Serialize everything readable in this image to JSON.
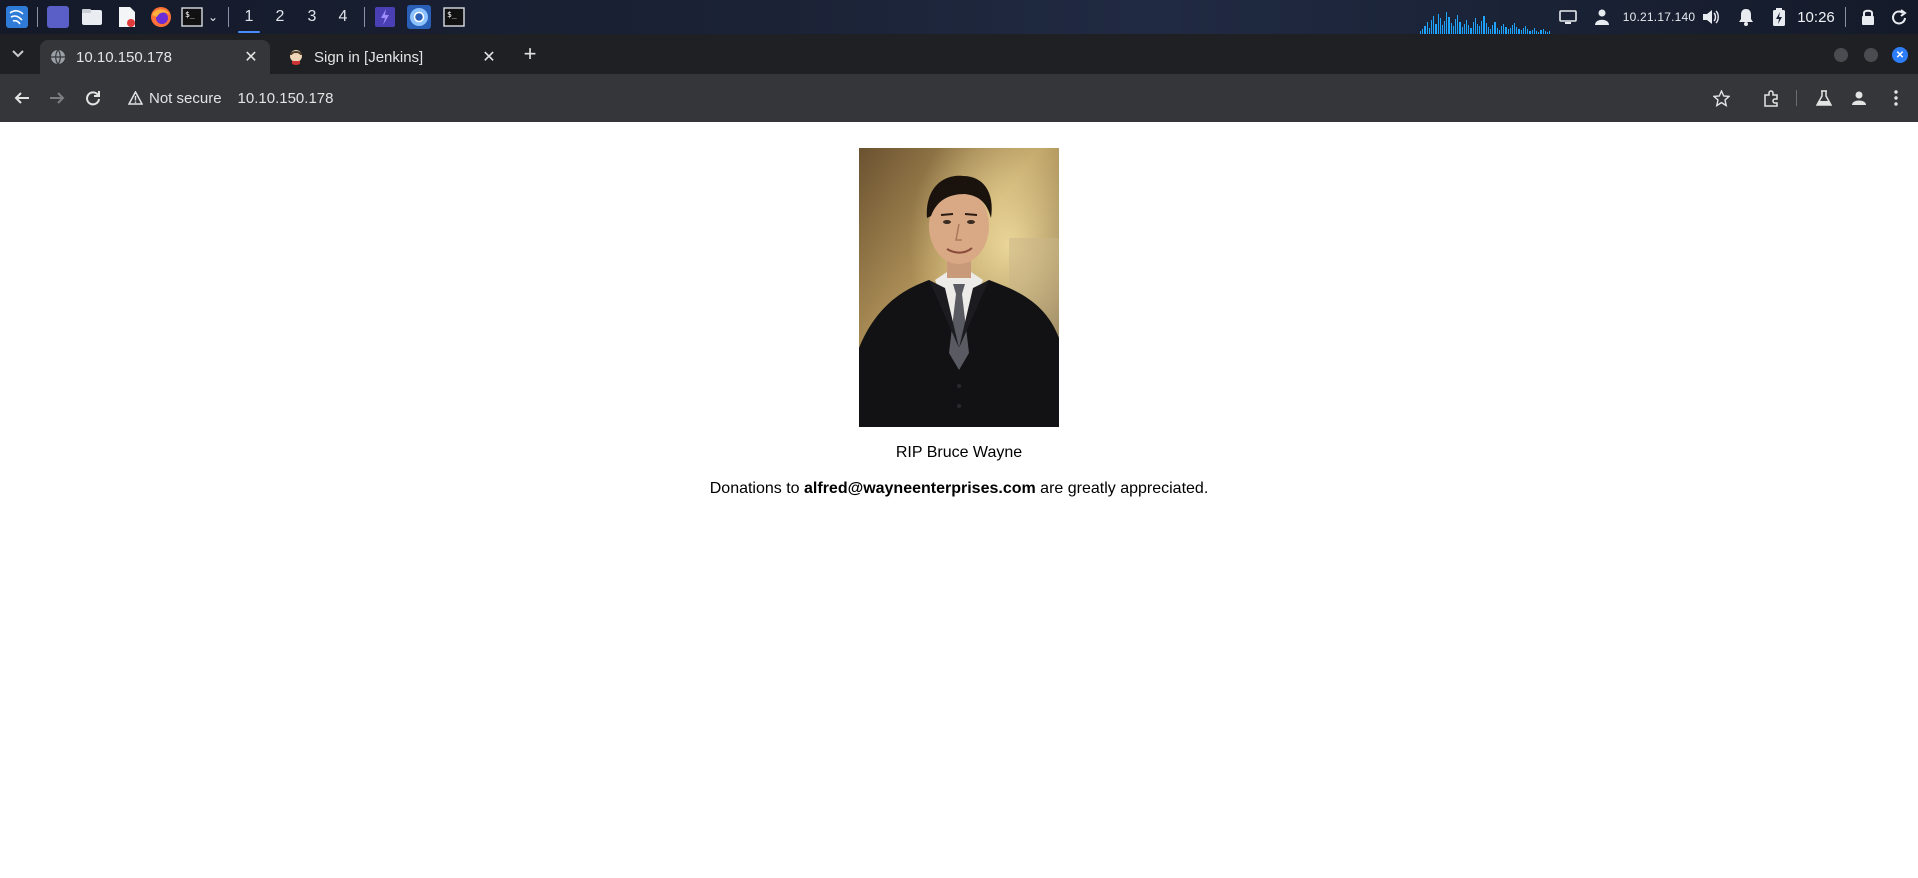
{
  "taskbar": {
    "workspaces": [
      "1",
      "2",
      "3",
      "4"
    ],
    "active_workspace": "1",
    "ip_address": "10.21.17.140",
    "clock": "10:26"
  },
  "browser": {
    "tabs": [
      {
        "title": "10.10.150.178",
        "active": true
      },
      {
        "title": "Sign in [Jenkins]",
        "active": false
      }
    ],
    "security_label": "Not secure",
    "url": "10.10.150.178"
  },
  "page": {
    "image_alt": "Portrait of a man in a dark suit",
    "rip_text": "RIP Bruce Wayne",
    "donation_prefix": "Donations to ",
    "donation_email": "alfred@wayneenterprises.com",
    "donation_suffix": " are greatly appreciated."
  },
  "colors": {
    "accent": "#4b8df8",
    "tab_active": "#35363a",
    "tab_strip": "#1f2023",
    "visualizer": "#1ea4ff"
  }
}
